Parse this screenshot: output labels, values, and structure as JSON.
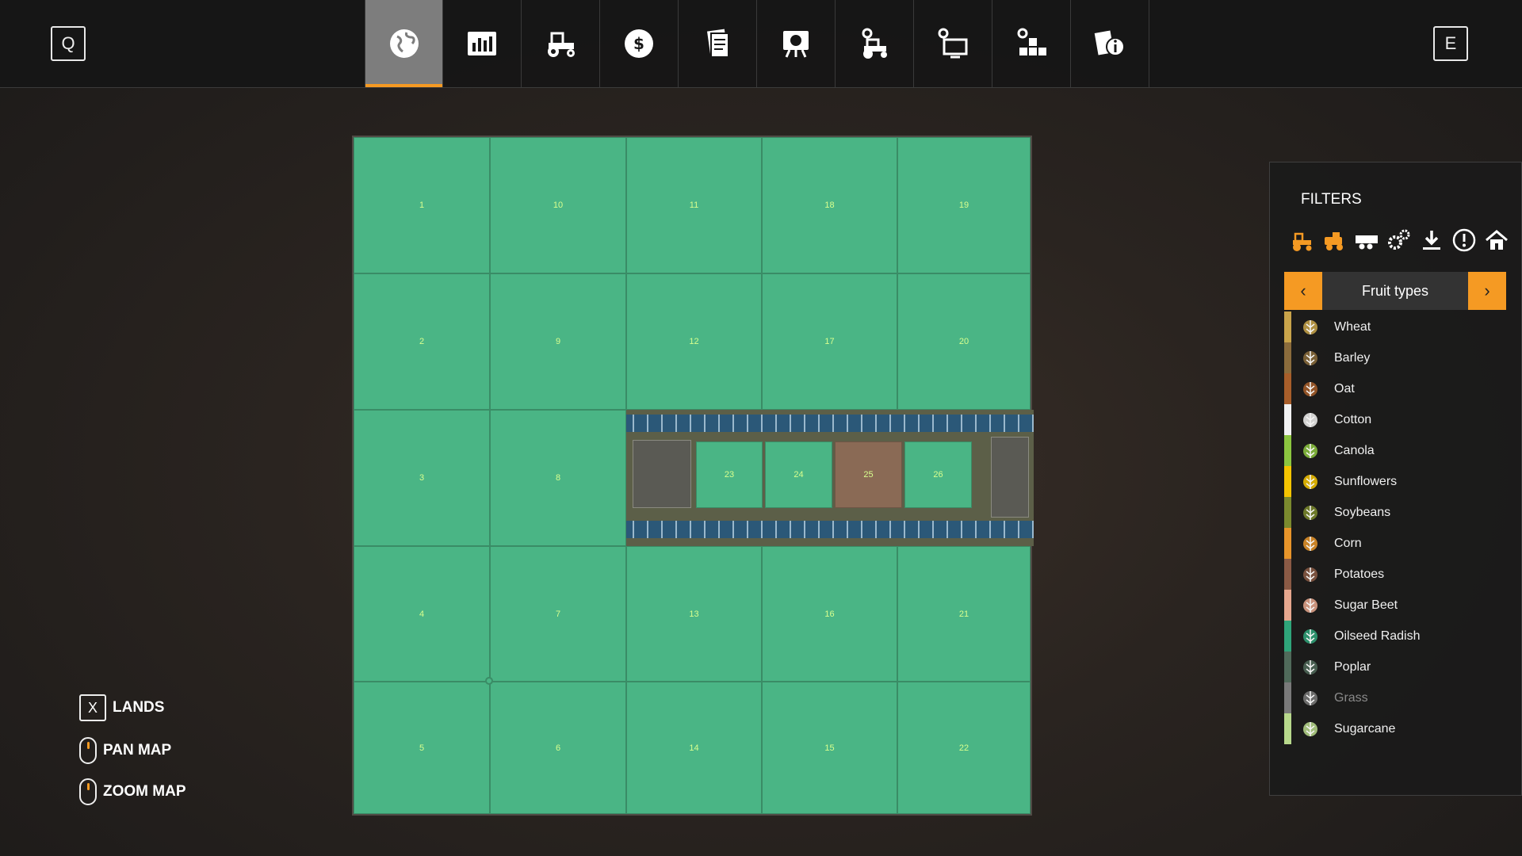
{
  "top": {
    "left_key": "Q",
    "right_key": "E"
  },
  "tabs": [
    {
      "icon": "globe-icon"
    },
    {
      "icon": "stats-icon"
    },
    {
      "icon": "tractor-icon"
    },
    {
      "icon": "money-icon"
    },
    {
      "icon": "contracts-icon"
    },
    {
      "icon": "animals-icon"
    },
    {
      "icon": "vehicle-settings-icon"
    },
    {
      "icon": "display-settings-icon"
    },
    {
      "icon": "production-icon"
    },
    {
      "icon": "help-info-icon"
    }
  ],
  "map": {
    "plots": [
      "1",
      "10",
      "11",
      "18",
      "19",
      "2",
      "9",
      "12",
      "17",
      "20",
      "3",
      "8",
      "23",
      "24",
      "25",
      "26",
      "4",
      "7",
      "13",
      "16",
      "21",
      "5",
      "6",
      "14",
      "15",
      "22"
    ]
  },
  "controls": {
    "lands_key": "X",
    "lands_label": "LANDS",
    "pan_label": "PAN MAP",
    "zoom_label": "ZOOM MAP"
  },
  "filters": {
    "title": "FILTERS",
    "selector_label": "Fruit types",
    "icons": [
      "tractor-icon",
      "harvester-icon",
      "trailer-icon",
      "tools-icon",
      "download-icon",
      "alert-icon",
      "home-icon"
    ],
    "fruits": [
      {
        "name": "Wheat",
        "color": "#c9a44a"
      },
      {
        "name": "Barley",
        "color": "#8b6c3c"
      },
      {
        "name": "Oat",
        "color": "#a85e2a"
      },
      {
        "name": "Cotton",
        "color": "#f2f2f2"
      },
      {
        "name": "Canola",
        "color": "#8cc63f"
      },
      {
        "name": "Sunflowers",
        "color": "#f5c400"
      },
      {
        "name": "Soybeans",
        "color": "#7b8a2e"
      },
      {
        "name": "Corn",
        "color": "#e8952a"
      },
      {
        "name": "Potatoes",
        "color": "#8a5a45"
      },
      {
        "name": "Sugar Beet",
        "color": "#e6a78e"
      },
      {
        "name": "Oilseed Radish",
        "color": "#2fa57a"
      },
      {
        "name": "Poplar",
        "color": "#506a5a"
      },
      {
        "name": "Grass",
        "color": "#7a7a7a"
      },
      {
        "name": "Sugarcane",
        "color": "#b8d98c"
      }
    ]
  }
}
